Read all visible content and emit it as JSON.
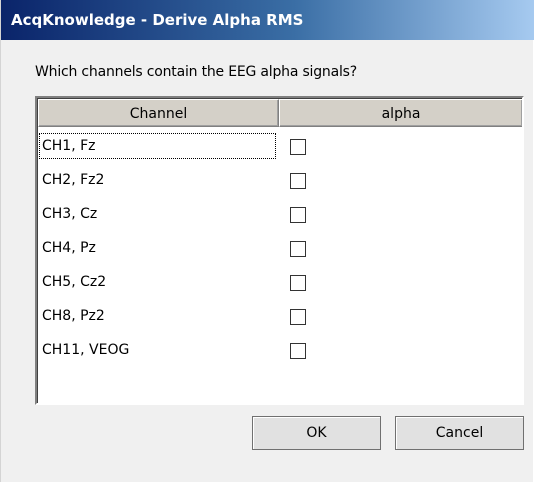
{
  "window": {
    "title": "AcqKnowledge - Derive Alpha RMS"
  },
  "prompt": "Which channels contain the EEG alpha signals?",
  "table": {
    "columns": [
      "Channel",
      "alpha"
    ],
    "rows": [
      {
        "channel": "CH1, Fz",
        "alpha": false
      },
      {
        "channel": "CH2, Fz2",
        "alpha": false
      },
      {
        "channel": "CH3, Cz",
        "alpha": false
      },
      {
        "channel": "CH4, Pz",
        "alpha": false
      },
      {
        "channel": "CH5, Cz2",
        "alpha": false
      },
      {
        "channel": "CH8, Pz2",
        "alpha": false
      },
      {
        "channel": "CH11, VEOG",
        "alpha": false
      }
    ]
  },
  "buttons": {
    "ok": "OK",
    "cancel": "Cancel"
  }
}
